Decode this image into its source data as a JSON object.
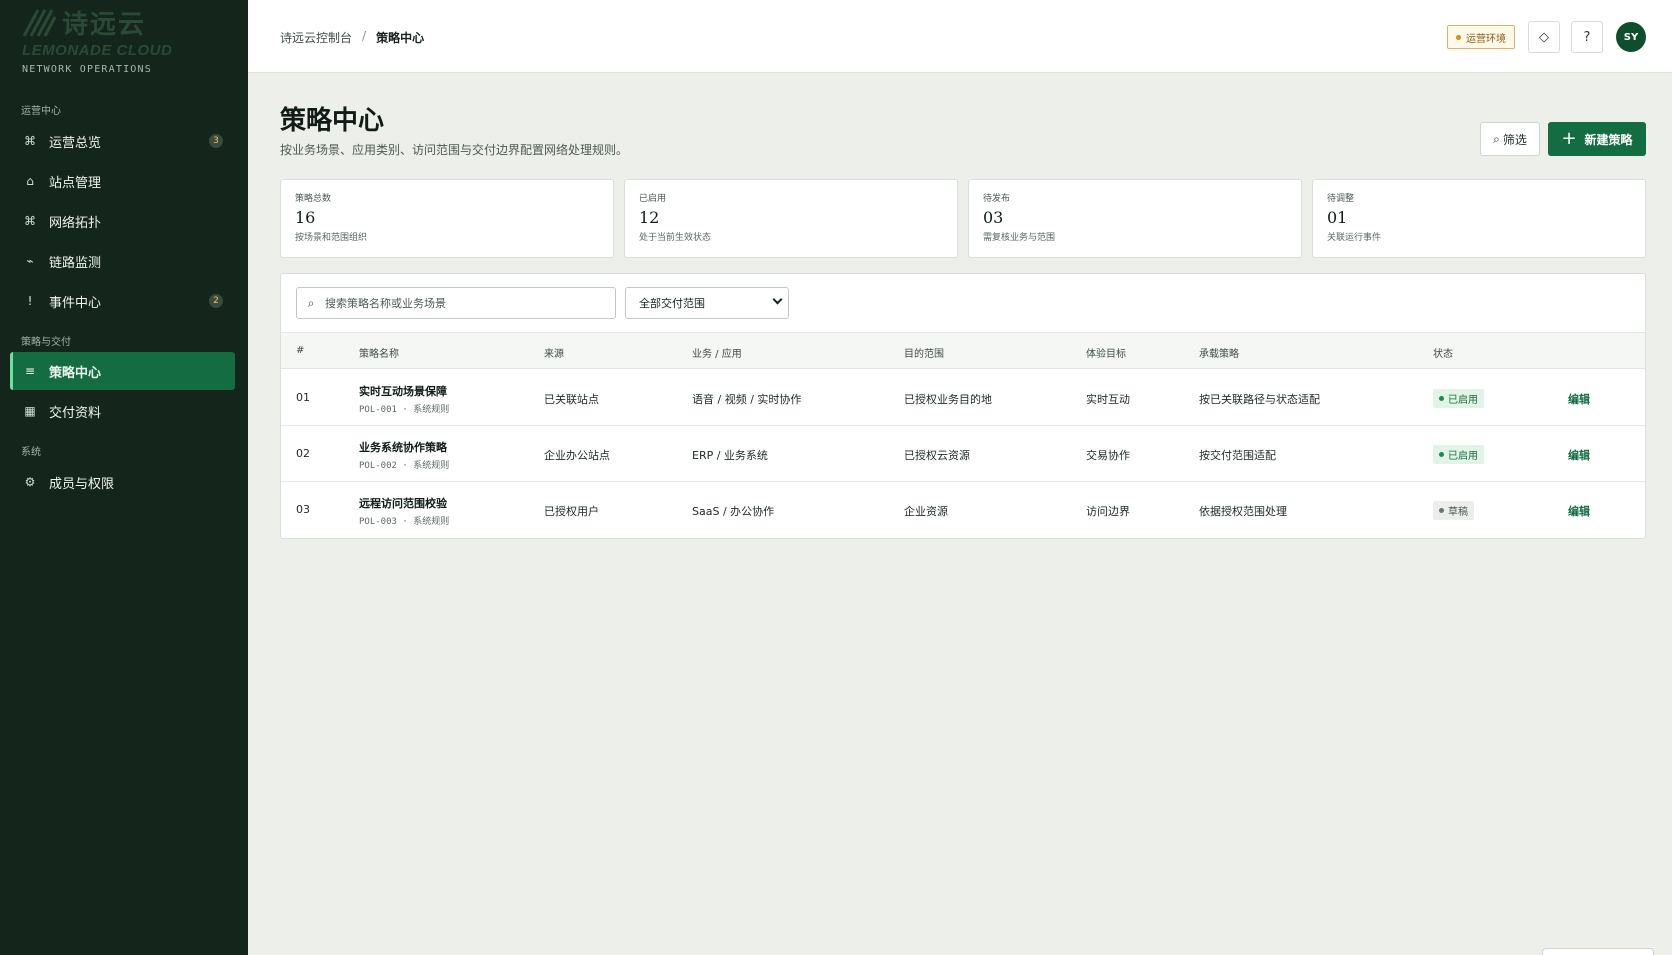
{
  "brand": {
    "name_cn": "诗远云",
    "name_en": "LEMONADE CLOUD",
    "subtitle": "NETWORK OPERATIONS"
  },
  "sidebar": {
    "groups": [
      {
        "label": "运营中心"
      },
      {
        "label": "策略与交付"
      },
      {
        "label": "系统"
      }
    ],
    "items": [
      {
        "label": "运营总览",
        "icon": "command-icon",
        "glyph": "⌘",
        "badge": "3"
      },
      {
        "label": "站点管理",
        "icon": "home-icon",
        "glyph": "⌂",
        "badge": ""
      },
      {
        "label": "网络拓扑",
        "icon": "topology-icon",
        "glyph": "⌘",
        "badge": ""
      },
      {
        "label": "链路监测",
        "icon": "pulse-icon",
        "glyph": "⌁",
        "badge": ""
      },
      {
        "label": "事件中心",
        "icon": "alert-icon",
        "glyph": "!",
        "badge": "2"
      },
      {
        "label": "策略中心",
        "icon": "list-icon",
        "glyph": "≡",
        "badge": "",
        "active": true
      },
      {
        "label": "交付资料",
        "icon": "document-icon",
        "glyph": "▦",
        "badge": ""
      },
      {
        "label": "成员与权限",
        "icon": "gear-icon",
        "glyph": "⚙",
        "badge": ""
      }
    ]
  },
  "topbar": {
    "breadcrumb": [
      "诗远云控制台",
      "策略中心"
    ],
    "breadcrumb_sep": "/",
    "env_label": "运营环境",
    "diamond_glyph": "◇",
    "help_glyph": "?",
    "avatar": "SY"
  },
  "page": {
    "title": "策略中心",
    "description": "按业务场景、应用类别、访问范围与交付边界配置网络处理规则。",
    "filter_label": "筛选",
    "filter_glyph": "⌕",
    "new_label": "新建策略",
    "new_glyph": "+"
  },
  "stats": [
    {
      "label": "策略总数",
      "value": "16",
      "note": "按场景和范围组织"
    },
    {
      "label": "已启用",
      "value": "12",
      "note": "处于当前生效状态"
    },
    {
      "label": "待发布",
      "value": "03",
      "note": "需复核业务与范围"
    },
    {
      "label": "待调整",
      "value": "01",
      "note": "关联运行事件"
    }
  ],
  "toolbar": {
    "search_placeholder": "搜索策略名称或业务场景",
    "search_glyph": "⌕",
    "scope_value": "全部交付范围"
  },
  "table": {
    "columns": [
      "#",
      "策略名称",
      "来源",
      "业务 / 应用",
      "目的范围",
      "体验目标",
      "承载策略",
      "状态"
    ],
    "rows": [
      {
        "no": "01",
        "name": "实时互动场景保障",
        "code": "POL-001",
        "sep": "·",
        "kind": "系统规则",
        "source": "已关联站点",
        "app": "语音 / 视频 / 实时协作",
        "dest": "已授权业务目的地",
        "goal": "实时互动",
        "policy": "按已关联路径与状态适配",
        "status": "已启用",
        "status_type": "on",
        "action": "编辑"
      },
      {
        "no": "02",
        "name": "业务系统协作策略",
        "code": "POL-002",
        "sep": "·",
        "kind": "系统规则",
        "source": "企业办公站点",
        "app": "ERP / 业务系统",
        "dest": "已授权云资源",
        "goal": "交易协作",
        "policy": "按交付范围适配",
        "status": "已启用",
        "status_type": "on",
        "action": "编辑"
      },
      {
        "no": "03",
        "name": "远程访问范围校验",
        "code": "POL-003",
        "sep": "·",
        "kind": "系统规则",
        "source": "已授权用户",
        "app": "SaaS / 办公协作",
        "dest": "企业资源",
        "goal": "访问边界",
        "policy": "依据授权范围处理",
        "status": "草稿",
        "status_type": "draft",
        "action": "编辑"
      }
    ]
  },
  "colors": {
    "sidebar_bg": "#14251c",
    "accent": "#136c42",
    "page_bg": "#ecefea",
    "env_badge": "#d98e15"
  }
}
